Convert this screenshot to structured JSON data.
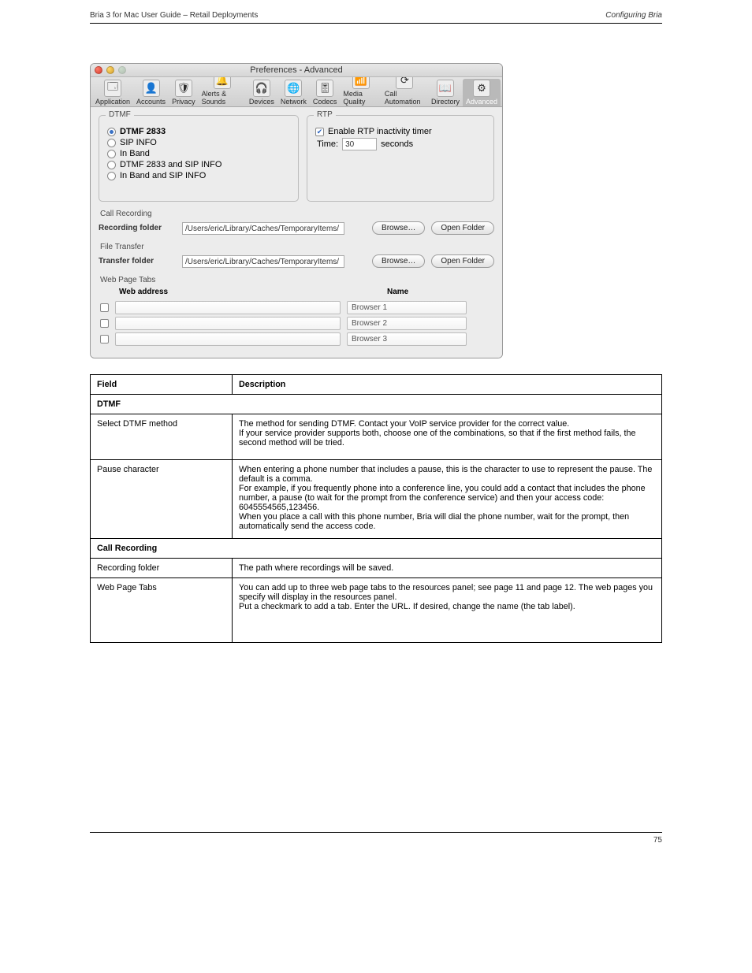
{
  "header": {
    "left": "Bria 3 for Mac User Guide – Retail Deployments",
    "right": "Configuring Bria"
  },
  "footer": {
    "page": "75"
  },
  "window": {
    "title": "Preferences - Advanced",
    "tabs": [
      {
        "label": "Application",
        "icon": "🗔"
      },
      {
        "label": "Accounts",
        "icon": "👤"
      },
      {
        "label": "Privacy",
        "icon": "🛡"
      },
      {
        "label": "Alerts & Sounds",
        "icon": "🔔"
      },
      {
        "label": "Devices",
        "icon": "🎧"
      },
      {
        "label": "Network",
        "icon": "🌐"
      },
      {
        "label": "Codecs",
        "icon": "🎚"
      },
      {
        "label": "Media Quality",
        "icon": "📶"
      },
      {
        "label": "Call Automation",
        "icon": "⟳"
      },
      {
        "label": "Directory",
        "icon": "📖"
      },
      {
        "label": "Advanced",
        "icon": "⚙"
      }
    ]
  },
  "dtmf": {
    "legend": "DTMF",
    "options": [
      "DTMF 2833",
      "SIP INFO",
      "In Band",
      "DTMF 2833 and SIP INFO",
      "In Band and SIP INFO"
    ],
    "selected": 0
  },
  "rtp": {
    "legend": "RTP",
    "checkbox_label": "Enable RTP inactivity timer",
    "checked": true,
    "time_label": "Time:",
    "time_value": "30",
    "seconds_label": "seconds"
  },
  "call_recording": {
    "legend": "Call Recording",
    "label": "Recording folder",
    "path": "/Users/eric/Library/Caches/TemporaryItems/",
    "browse": "Browse…",
    "open": "Open Folder"
  },
  "file_transfer": {
    "legend": "File Transfer",
    "label": "Transfer folder",
    "path": "/Users/eric/Library/Caches/TemporaryItems/",
    "browse": "Browse…",
    "open": "Open Folder"
  },
  "web_tabs": {
    "legend": "Web Page Tabs",
    "col1": "Web address",
    "col2": "Name",
    "rows": [
      {
        "name": "Browser 1"
      },
      {
        "name": "Browser 2"
      },
      {
        "name": "Browser 3"
      }
    ]
  },
  "table": {
    "h1": "Field",
    "h2": "Description",
    "section1": "DTMF",
    "r1a": "Select DTMF method",
    "r1b": "The method for sending DTMF. Contact your VoIP service provider for the correct value.\nIf your service provider supports both, choose one of the combinations, so that if the first method fails, the second method will be tried.",
    "r2a": "Pause character",
    "r2b": "When entering a phone number that includes a pause, this is the character to use to represent the pause. The default is a comma.\nFor example, if you frequently phone into a conference line, you could add a contact that includes the phone number, a pause (to wait for the prompt from the conference service) and then your access code:\n6045554565,123456.\nWhen you place a call with this phone number, Bria will dial the phone number, wait for the prompt, then automatically send the access code.",
    "section2": "Call Recording",
    "r3a": "Recording folder",
    "r3b": "The path where recordings will be saved.",
    "r4a": "Web Page Tabs",
    "r4b": "You can add up to three web page tabs to the resources panel; see page 11 and page 12. The web pages you specify will display in the resources panel.\nPut a checkmark to add a tab. Enter the URL. If desired, change the name (the tab label)."
  }
}
